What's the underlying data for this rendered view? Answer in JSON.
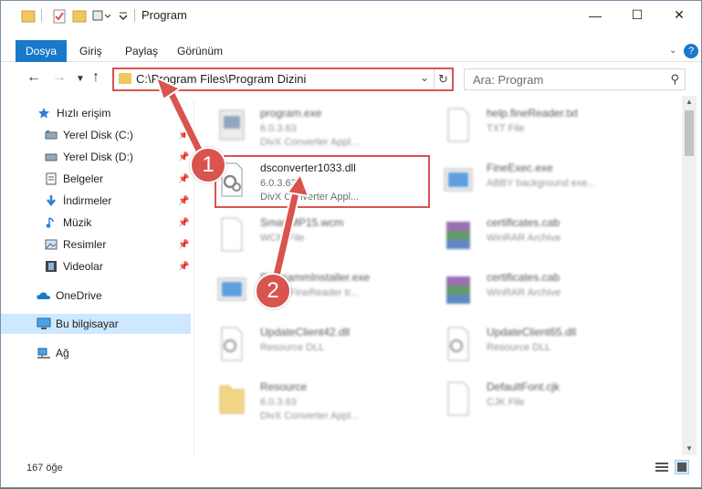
{
  "window": {
    "title": "Program"
  },
  "ribbon": {
    "tabs": [
      "Dosya",
      "Giriş",
      "Paylaş",
      "Görünüm"
    ]
  },
  "address": {
    "path": "C:\\Program Files\\Program Dizini"
  },
  "search": {
    "placeholder": "Ara: Program"
  },
  "sidebar": {
    "items": [
      {
        "label": "Hızlı erişim",
        "icon": "star-icon",
        "pinned": false
      },
      {
        "label": "Yerel Disk (C:)",
        "icon": "drive-icon",
        "pinned": true
      },
      {
        "label": "Yerel Disk (D:)",
        "icon": "drive-icon",
        "pinned": true
      },
      {
        "label": "Belgeler",
        "icon": "documents-icon",
        "pinned": true
      },
      {
        "label": "İndirmeler",
        "icon": "download-icon",
        "pinned": true
      },
      {
        "label": "Müzik",
        "icon": "music-icon",
        "pinned": true
      },
      {
        "label": "Resimler",
        "icon": "pictures-icon",
        "pinned": true
      },
      {
        "label": "Videolar",
        "icon": "video-icon",
        "pinned": true
      },
      {
        "label": "OneDrive",
        "icon": "cloud-icon",
        "pinned": false
      },
      {
        "label": "Bu bilgisayar",
        "icon": "computer-icon",
        "pinned": false
      },
      {
        "label": "Ağ",
        "icon": "network-icon",
        "pinned": false
      }
    ],
    "selected": "Bu bilgisayar"
  },
  "files": [
    {
      "name": "program.exe",
      "line2": "6.0.3.63",
      "line3": "DivX Converter Appl...",
      "icon": "exe-icon"
    },
    {
      "name": "help.fineReader.txt",
      "line2": "TXT File",
      "line3": "",
      "icon": "text-file-icon"
    },
    {
      "name": "dsconverter1033.dll",
      "line2": "6.0.3.63",
      "line3": "DivX Converter Appl...",
      "icon": "dll-icon"
    },
    {
      "name": "FineExec.exe",
      "line2": "ABBY background exe...",
      "line3": "",
      "icon": "exe-icon"
    },
    {
      "name": "SmartMP15.wcm",
      "line2": "WCM File",
      "line3": "",
      "icon": "generic-file-icon"
    },
    {
      "name": "certificates.cab",
      "line2": "WinRAR Archive",
      "line3": "",
      "icon": "archive-icon"
    },
    {
      "name": "ProgrammInstaller.exe",
      "line2": "ABBY FineReader tr...",
      "line3": "",
      "icon": "exe-icon"
    },
    {
      "name": "certificates.cab",
      "line2": "WinRAR Archive",
      "line3": "",
      "icon": "archive-icon"
    },
    {
      "name": "UpdateClient42.dll",
      "line2": "Resource DLL",
      "line3": "",
      "icon": "dll-icon"
    },
    {
      "name": "UpdateClient65.dll",
      "line2": "Resource DLL",
      "line3": "",
      "icon": "dll-icon"
    },
    {
      "name": "Resource",
      "line2": "6.0.3.63",
      "line3": "DivX Converter Appl...",
      "icon": "folder-icon"
    },
    {
      "name": "DefaultFont.cjk",
      "line2": "CJK File",
      "line3": "",
      "icon": "generic-file-icon"
    }
  ],
  "status": {
    "count": "167 öğe"
  },
  "callouts": [
    "1",
    "2"
  ],
  "colors": {
    "accent": "#1979ca",
    "highlight": "#d9534f",
    "selection": "#cde8ff"
  }
}
